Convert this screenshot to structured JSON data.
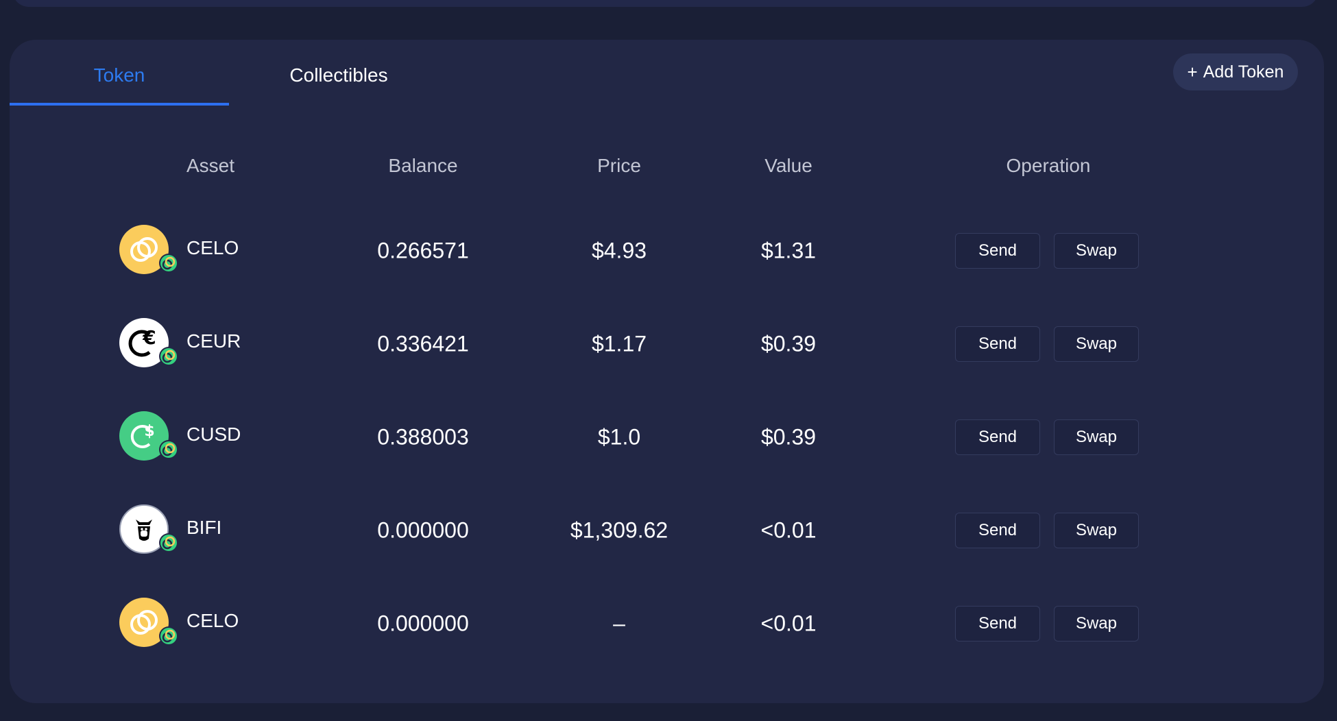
{
  "tabs": [
    {
      "label": "Token",
      "active": true
    },
    {
      "label": "Collectibles",
      "active": false
    }
  ],
  "add_token": {
    "plus": "+",
    "label": "Add Token"
  },
  "columns": {
    "asset": "Asset",
    "balance": "Balance",
    "price": "Price",
    "value": "Value",
    "operation": "Operation"
  },
  "rows": [
    {
      "symbol": "CELO",
      "icon": "celo-coin-icon",
      "balance": "0.266571",
      "price": "$4.93",
      "value": "$1.31",
      "send": "Send",
      "swap": "Swap"
    },
    {
      "symbol": "CEUR",
      "icon": "ceur-coin-icon",
      "balance": "0.336421",
      "price": "$1.17",
      "value": "$0.39",
      "send": "Send",
      "swap": "Swap"
    },
    {
      "symbol": "CUSD",
      "icon": "cusd-coin-icon",
      "balance": "0.388003",
      "price": "$1.0",
      "value": "$0.39",
      "send": "Send",
      "swap": "Swap"
    },
    {
      "symbol": "BIFI",
      "icon": "bifi-coin-icon",
      "balance": "0.000000",
      "price": "$1,309.62",
      "value": "<0.01",
      "send": "Send",
      "swap": "Swap"
    },
    {
      "symbol": "CELO",
      "icon": "celo-coin-icon",
      "balance": "0.000000",
      "price": "–",
      "value": "<0.01",
      "send": "Send",
      "swap": "Swap"
    }
  ],
  "colors": {
    "background": "#1a1f36",
    "panel": "#222745",
    "accent": "#2d7bf0",
    "celo": "#fbcc5c",
    "cusd": "#45cd85"
  }
}
